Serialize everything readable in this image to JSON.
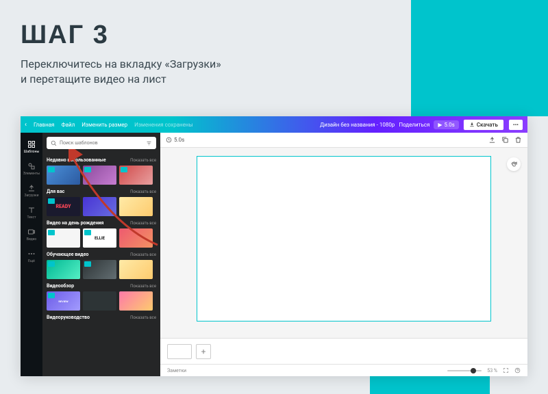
{
  "hero": {
    "title": "ШАГ 3",
    "line1": "Переключитесь на вкладку «Загрузки»",
    "line2": "и перетащите видео на лист"
  },
  "topbar": {
    "home": "Главная",
    "file": "Файл",
    "resize": "Изменить размер",
    "undo_hint": "Изменения сохранены",
    "doc_title": "Дизайн без названия - 1080p",
    "share": "Поделиться",
    "play_time": "5.0s",
    "download": "Скачать"
  },
  "rail": {
    "templates": "Шаблоны",
    "elements": "Элементы",
    "uploads": "Загрузки",
    "text": "Текст",
    "video": "Видео",
    "more": "Ещё"
  },
  "search": {
    "placeholder": "Поиск шаблонов"
  },
  "sections": [
    {
      "title": "Недавно использованные",
      "all": "Показать все"
    },
    {
      "title": "Для вас",
      "all": "Показать все"
    },
    {
      "title": "Видео на день рождения",
      "all": "Показать все"
    },
    {
      "title": "Обучающее видео",
      "all": "Показать все"
    },
    {
      "title": "Видеообзор",
      "all": "Показать все"
    },
    {
      "title": "Видеоруководство",
      "all": "Показать все"
    }
  ],
  "canvas": {
    "timer": "5.0s"
  },
  "footer": {
    "notes": "Заметки",
    "zoom": "53 %"
  }
}
